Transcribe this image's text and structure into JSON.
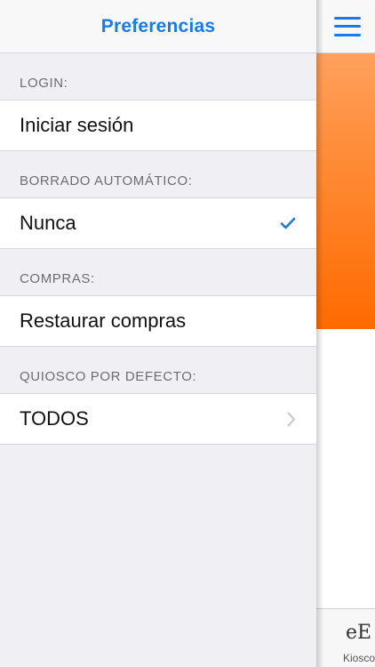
{
  "panel": {
    "title": "Preferencias",
    "sections": [
      {
        "header": "LOGIN:",
        "cell": "Iniciar sesión"
      },
      {
        "header": "BORRADO AUTOMÁTICO:",
        "cell": "Nunca"
      },
      {
        "header": "COMPRAS:",
        "cell": "Restaurar compras"
      },
      {
        "header": "QUIOSCO POR DEFECTO:",
        "cell": "TODOS"
      }
    ]
  },
  "right": {
    "tab_logo": "eE",
    "tab_label": "Kiosco"
  },
  "icons": {
    "menu": "hamburger-menu-icon",
    "check": "checkmark-icon",
    "chevron": "chevron-right-icon"
  },
  "colors": {
    "accent": "#1a7ae6",
    "banner_top": "#ffa05c",
    "banner_bottom": "#ff6a00"
  }
}
